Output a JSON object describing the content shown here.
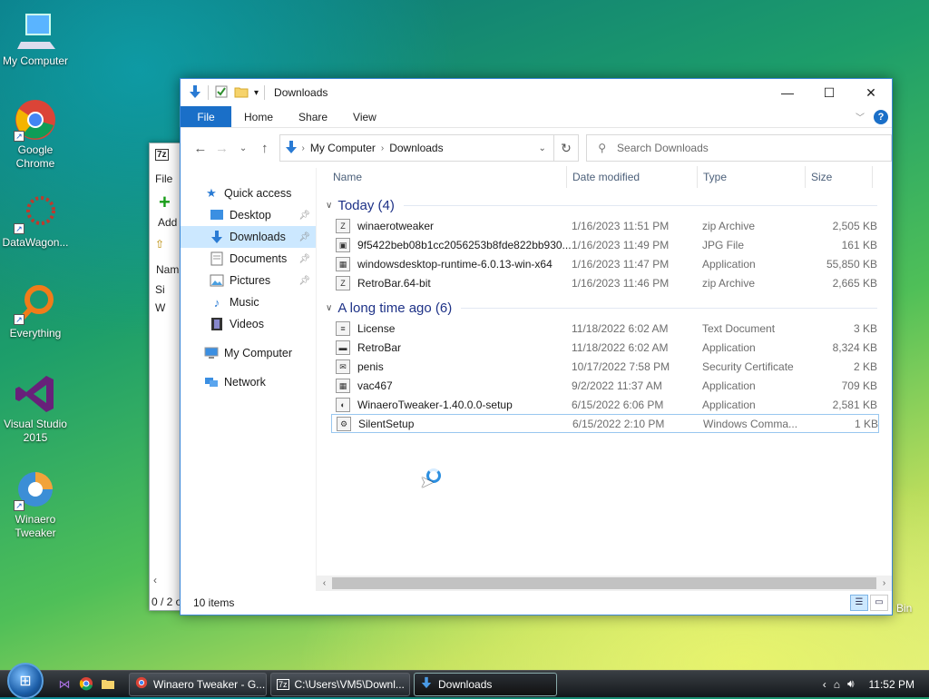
{
  "desktop": {
    "icons": [
      {
        "label": "My Computer"
      },
      {
        "label": "Google Chrome"
      },
      {
        "label": "DataWagon..."
      },
      {
        "label": "Everything"
      },
      {
        "label": "Visual Studio 2015"
      },
      {
        "label": "Winaero Tweaker"
      }
    ],
    "recycle_bin": "Bin"
  },
  "bg_window": {
    "title": "7z",
    "menu_file": "File",
    "add": "Add",
    "col_name": "Nam",
    "row1": "Si",
    "row2": "W",
    "status": "0 / 2 o"
  },
  "explorer": {
    "title": "Downloads",
    "ribbon": {
      "file": "File",
      "home": "Home",
      "share": "Share",
      "view": "View"
    },
    "address": {
      "root": "My Computer",
      "current": "Downloads"
    },
    "search_placeholder": "Search Downloads",
    "nav": [
      {
        "label": "Quick access"
      },
      {
        "label": "Desktop"
      },
      {
        "label": "Downloads"
      },
      {
        "label": "Documents"
      },
      {
        "label": "Pictures"
      },
      {
        "label": "Music"
      },
      {
        "label": "Videos"
      },
      {
        "label": "My Computer"
      },
      {
        "label": "Network"
      }
    ],
    "columns": {
      "name": "Name",
      "date": "Date modified",
      "type": "Type",
      "size": "Size"
    },
    "groups": [
      {
        "header": "Today (4)",
        "rows": [
          {
            "name": "winaerotweaker",
            "date": "1/16/2023 11:51 PM",
            "type": "zip Archive",
            "size": "2,505 KB",
            "icon": "Z"
          },
          {
            "name": "9f5422beb08b1cc2056253b8fde822bb930...",
            "date": "1/16/2023 11:49 PM",
            "type": "JPG File",
            "size": "161 KB",
            "icon": "▣"
          },
          {
            "name": "windowsdesktop-runtime-6.0.13-win-x64",
            "date": "1/16/2023 11:47 PM",
            "type": "Application",
            "size": "55,850 KB",
            "icon": "▦"
          },
          {
            "name": "RetroBar.64-bit",
            "date": "1/16/2023 11:46 PM",
            "type": "zip Archive",
            "size": "2,665 KB",
            "icon": "Z"
          }
        ]
      },
      {
        "header": "A long time ago (6)",
        "rows": [
          {
            "name": "License",
            "date": "11/18/2022 6:02 AM",
            "type": "Text Document",
            "size": "3 KB",
            "icon": "≡"
          },
          {
            "name": "RetroBar",
            "date": "11/18/2022 6:02 AM",
            "type": "Application",
            "size": "8,324 KB",
            "icon": "▬"
          },
          {
            "name": "penis",
            "date": "10/17/2022 7:58 PM",
            "type": "Security Certificate",
            "size": "2 KB",
            "icon": "✉"
          },
          {
            "name": "vac467",
            "date": "9/2/2022 11:37 AM",
            "type": "Application",
            "size": "709 KB",
            "icon": "▦"
          },
          {
            "name": "WinaeroTweaker-1.40.0.0-setup",
            "date": "6/15/2022 6:06 PM",
            "type": "Application",
            "size": "2,581 KB",
            "icon": "◐"
          },
          {
            "name": "SilentSetup",
            "date": "6/15/2022 2:10 PM",
            "type": "Windows Comma...",
            "size": "1 KB",
            "icon": "⚙"
          }
        ]
      }
    ],
    "status": "10 items"
  },
  "taskbar": {
    "buttons": [
      {
        "label": "Winaero Tweaker - G..."
      },
      {
        "label": "C:\\Users\\VM5\\Downl..."
      },
      {
        "label": "Downloads"
      }
    ],
    "clock": "11:52 PM"
  }
}
